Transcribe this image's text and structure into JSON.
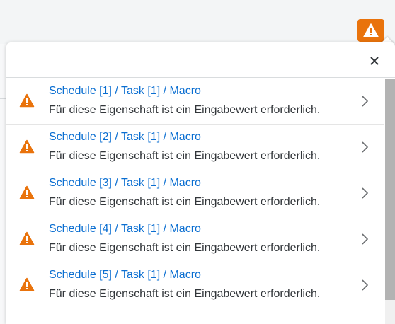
{
  "trigger": {
    "icon": "warning-icon",
    "color": "#e9730c"
  },
  "popover": {
    "close_icon": "close-icon",
    "items": [
      {
        "title": "Schedule [1] / Task [1] / Macro",
        "description": "Für diese Eigenschaft ist ein Eingabewert erforderlich.",
        "icon": "warning-icon"
      },
      {
        "title": "Schedule [2] / Task [1] / Macro",
        "description": "Für diese Eigenschaft ist ein Eingabewert erforderlich.",
        "icon": "warning-icon"
      },
      {
        "title": "Schedule [3] / Task [1] / Macro",
        "description": "Für diese Eigenschaft ist ein Eingabewert erforderlich.",
        "icon": "warning-icon"
      },
      {
        "title": "Schedule [4] / Task [1] / Macro",
        "description": "Für diese Eigenschaft ist ein Eingabewert erforderlich.",
        "icon": "warning-icon"
      },
      {
        "title": "Schedule [5] / Task [1] / Macro",
        "description": "Für diese Eigenschaft ist ein Eingabewert erforderlich.",
        "icon": "warning-icon"
      }
    ]
  },
  "colors": {
    "warning": "#e9730c",
    "link": "#0a6ed1",
    "text": "#32363a"
  }
}
